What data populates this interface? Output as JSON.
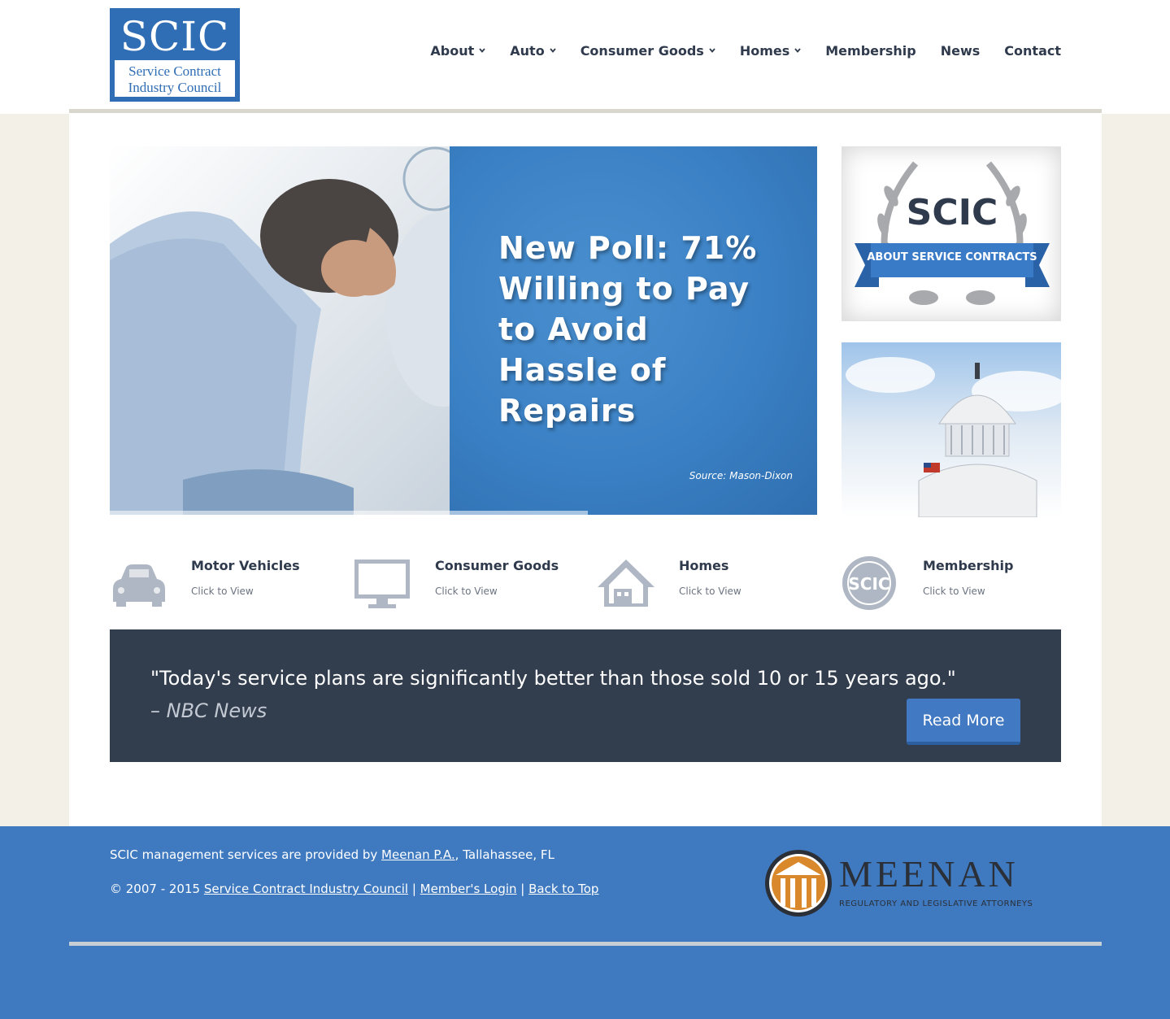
{
  "logo": {
    "abbr": "SCIC",
    "line1": "Service Contract",
    "line2": "Industry Council"
  },
  "nav": {
    "items": [
      {
        "label": "About",
        "has_dropdown": true
      },
      {
        "label": "Auto",
        "has_dropdown": true
      },
      {
        "label": "Consumer Goods",
        "has_dropdown": true
      },
      {
        "label": "Homes",
        "has_dropdown": true
      },
      {
        "label": "Membership",
        "has_dropdown": false
      },
      {
        "label": "News",
        "has_dropdown": false
      },
      {
        "label": "Contact",
        "has_dropdown": false
      }
    ]
  },
  "hero": {
    "headline": "New Poll: 71% Willing to Pay to Avoid Hassle of Repairs",
    "source": "Source: Mason-Dixon",
    "progress": 0.676
  },
  "side": {
    "about_title": "SCIC",
    "about_ribbon": "ABOUT SERVICE CONTRACTS"
  },
  "categories": [
    {
      "title": "Motor Vehicles",
      "link": "Click to View",
      "icon": "car-icon"
    },
    {
      "title": "Consumer Goods",
      "link": "Click to View",
      "icon": "monitor-icon"
    },
    {
      "title": "Homes",
      "link": "Click to View",
      "icon": "house-icon"
    },
    {
      "title": "Membership",
      "link": "Click to View",
      "icon": "scic-seal-icon"
    }
  ],
  "quote": {
    "text": "\"Today's service plans are significantly better than those sold 10 or 15 years ago.\"",
    "source": "– NBC News",
    "button": "Read More"
  },
  "footer": {
    "line1_prefix": "SCIC management services are provided by ",
    "line1_link": "Meenan P.A.",
    "line1_suffix": ", Tallahassee, FL",
    "copyright": "© 2007 - 2015 ",
    "link_council": "Service Contract Industry Council",
    "sep": " | ",
    "link_login": "Member's Login",
    "link_top": "Back to Top",
    "meenan_word": "MEENAN",
    "meenan_sub": "REGULATORY AND LEGISLATIVE ATTORNEYS"
  },
  "colors": {
    "brand_blue": "#3f79bf",
    "dark_navy": "#323d4e",
    "text_dark": "#2f3a4c",
    "gold": "#d9892b"
  }
}
